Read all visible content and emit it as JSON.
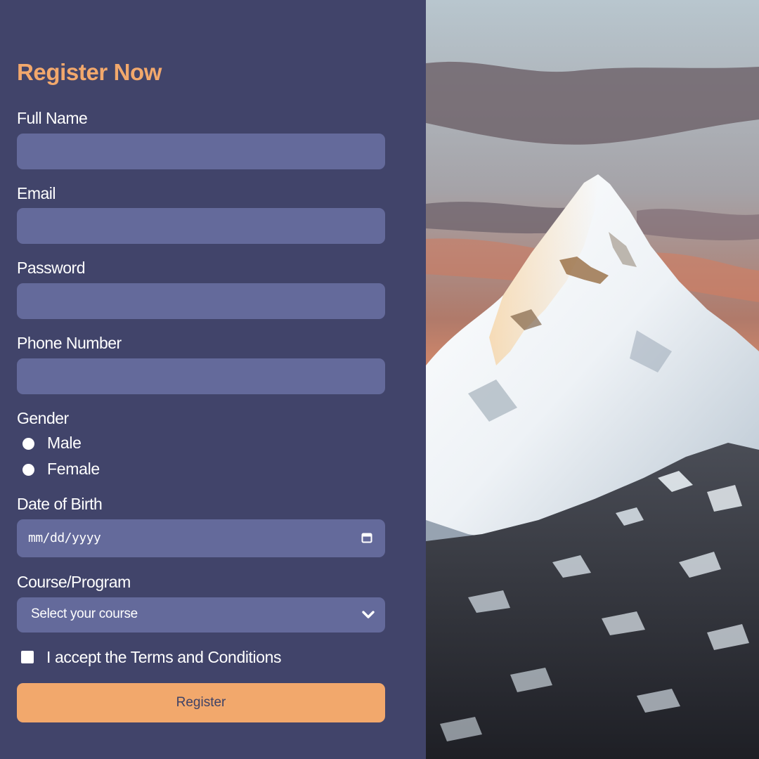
{
  "colors": {
    "panel_bg": "#41446a",
    "field_bg": "#646a9b",
    "accent": "#f2a86c",
    "text": "#ffffff",
    "button_text": "#3e4266"
  },
  "form": {
    "title": "Register Now",
    "full_name": {
      "label": "Full Name",
      "value": ""
    },
    "email": {
      "label": "Email",
      "value": ""
    },
    "password": {
      "label": "Password",
      "value": ""
    },
    "phone": {
      "label": "Phone Number",
      "value": ""
    },
    "gender": {
      "label": "Gender",
      "options": [
        {
          "label": "Male",
          "selected": false
        },
        {
          "label": "Female",
          "selected": false
        }
      ]
    },
    "dob": {
      "label": "Date of Birth",
      "placeholder": "mm/dd/yyyy",
      "icon": "calendar-icon"
    },
    "course": {
      "label": "Course/Program",
      "selected": "Select your course",
      "icon": "chevron-down-icon"
    },
    "terms": {
      "label": "I accept the Terms and Conditions",
      "checked": false
    },
    "submit_label": "Register"
  },
  "photo": {
    "subject": "mountain-photo"
  }
}
